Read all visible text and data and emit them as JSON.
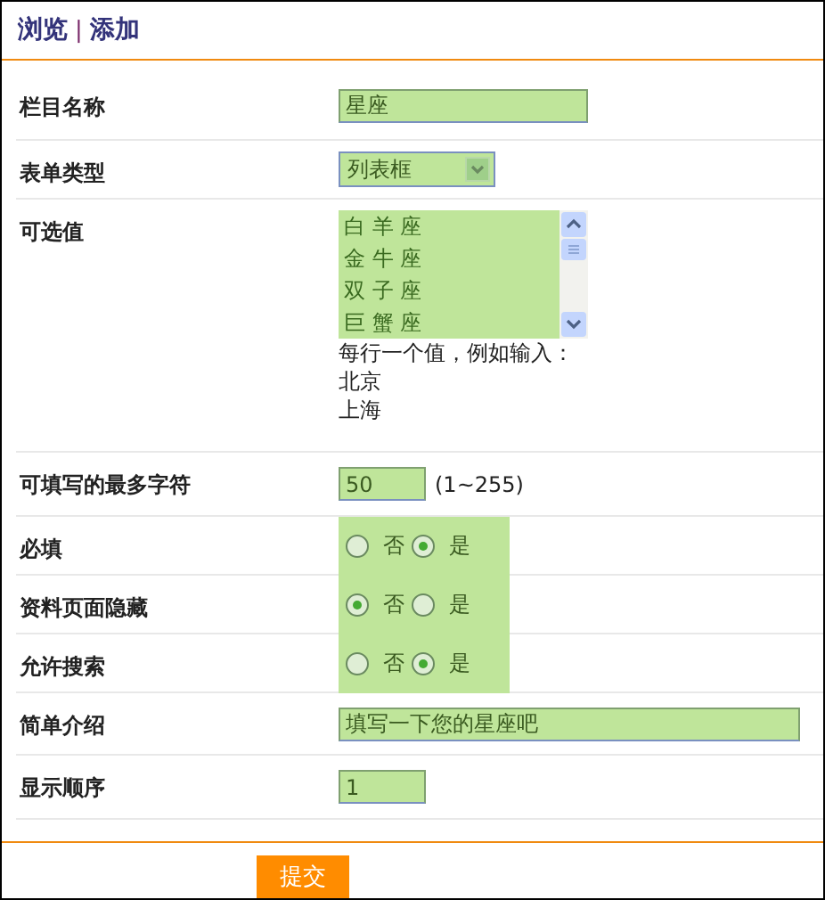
{
  "nav": {
    "links": [
      "浏览",
      "添加"
    ],
    "separator": "|"
  },
  "fields": [
    {
      "kind": "text",
      "label": "栏目名称",
      "value": "星座"
    },
    {
      "kind": "select",
      "label": "表单类型",
      "value": "列表框"
    },
    {
      "kind": "listbox",
      "label": "可选值",
      "items": [
        "白 羊 座",
        "金 牛 座",
        "双 子 座",
        "巨 蟹 座"
      ],
      "hint": [
        "每行一个值，例如输入：",
        "北京",
        "上海"
      ]
    },
    {
      "kind": "number",
      "label": "可填写的最多字符",
      "value": "50",
      "note": "(1~255)"
    },
    {
      "kind": "radio",
      "label": "必填",
      "options": [
        {
          "label": "否",
          "selected": false
        },
        {
          "label": "是",
          "selected": true
        }
      ]
    },
    {
      "kind": "radio",
      "label": "资料页面隐藏",
      "options": [
        {
          "label": "否",
          "selected": true
        },
        {
          "label": "是",
          "selected": false
        }
      ]
    },
    {
      "kind": "radio",
      "label": "允许搜索",
      "options": [
        {
          "label": "否",
          "selected": false
        },
        {
          "label": "是",
          "selected": true
        }
      ]
    },
    {
      "kind": "wide",
      "label": "简单介绍",
      "value": "填写一下您的星座吧"
    },
    {
      "kind": "number",
      "label": "显示顺序",
      "value": "1"
    }
  ],
  "submit": "提交"
}
